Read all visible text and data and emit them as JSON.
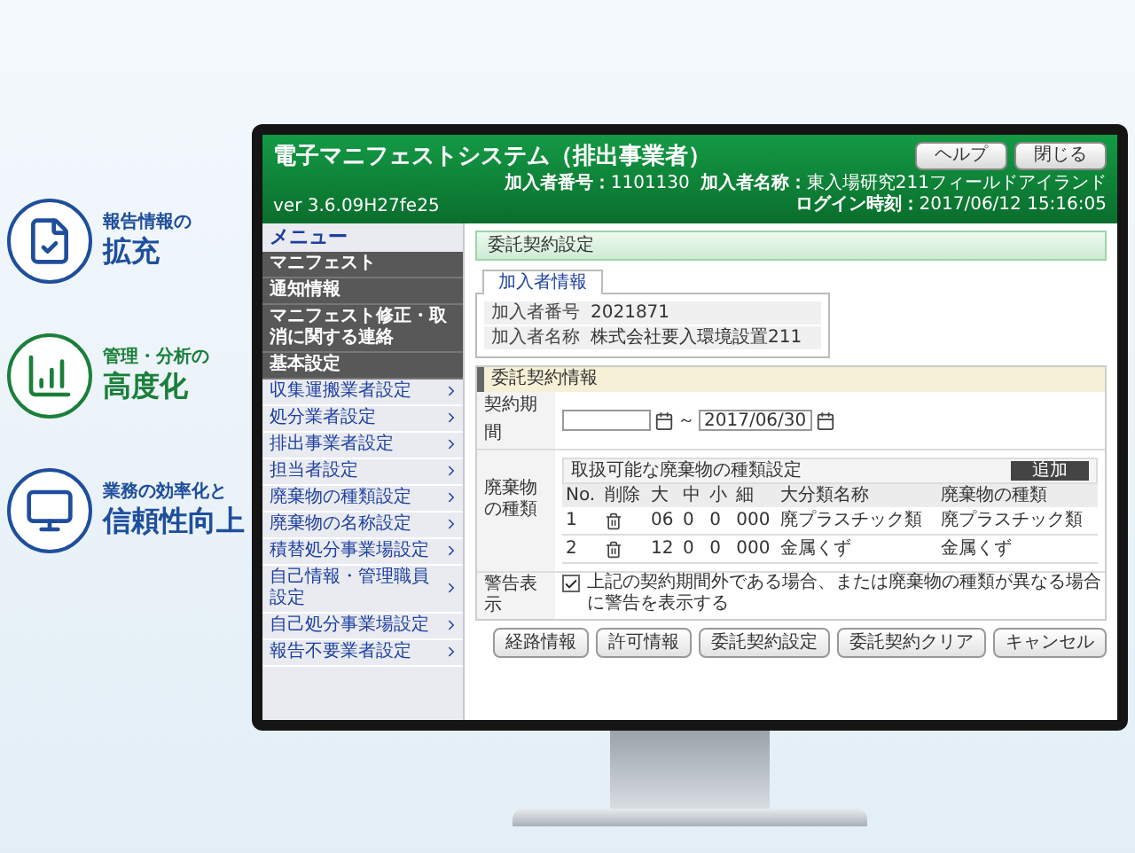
{
  "features": [
    {
      "kind": "document",
      "color": "#1f4e9c",
      "line1": "報告情報の",
      "line2": "拡充"
    },
    {
      "kind": "chart",
      "color": "#1b7f3a",
      "line1": "管理・分析の",
      "line2": "高度化"
    },
    {
      "kind": "monitor",
      "color": "#1f4e9c",
      "line1": "業務の効率化と",
      "line2": "信頼性向上"
    }
  ],
  "app": {
    "title": "電子マニフェストシステム（排出事業者）",
    "version": "ver 3.6.09H27fe25",
    "buttons": [
      "ヘルプ",
      "閉じる"
    ],
    "info": [
      {
        "label": "加入者番号：",
        "value": "1101130"
      },
      {
        "label": "加入者名称：",
        "value": "東入場研究211フィールドアイランド"
      },
      {
        "label": "ログイン時刻：",
        "value": "2017/06/12 15:16:05"
      }
    ]
  },
  "menu": {
    "title": "メニュー",
    "items": [
      {
        "kind": "header",
        "label": "マニフェスト"
      },
      {
        "kind": "header",
        "label": "通知情報"
      },
      {
        "kind": "header",
        "label": "マニフェスト修正・取消に関する連絡"
      },
      {
        "kind": "header",
        "label": "基本設定"
      },
      {
        "kind": "link",
        "label": "収集運搬業者設定"
      },
      {
        "kind": "link",
        "label": "処分業者設定"
      },
      {
        "kind": "link",
        "label": "排出事業者設定"
      },
      {
        "kind": "link",
        "label": "担当者設定"
      },
      {
        "kind": "link",
        "label": "廃棄物の種類設定"
      },
      {
        "kind": "link",
        "label": "廃棄物の名称設定"
      },
      {
        "kind": "link",
        "label": "積替処分事業場設定"
      },
      {
        "kind": "link",
        "label": "自己情報・管理職員設定"
      },
      {
        "kind": "link",
        "label": "自己処分事業場設定"
      },
      {
        "kind": "link",
        "label": "報告不要業者設定"
      }
    ]
  },
  "page": {
    "title": "委託契約設定",
    "tabs": [
      {
        "label": "加入者情報",
        "selected": true
      }
    ],
    "member_info": [
      {
        "label": "加入者番号",
        "value": "2021871"
      },
      {
        "label": "加入者名称",
        "value": "株式会社要入環境設置211"
      }
    ]
  },
  "contract": {
    "title": "委託契約情報",
    "period": {
      "label": "契約期間",
      "end": "2017/06/30",
      "separator": "～"
    },
    "waste": {
      "label": "廃棄物の種類",
      "table_title": "取扱可能な廃棄物の種類設定",
      "add_button": "追加",
      "columns": [
        "No.",
        "削除",
        "大",
        "中",
        "小",
        "細",
        "大分類名称",
        "廃棄物の種類"
      ],
      "rows": [
        {
          "no": "1",
          "major": "06",
          "middle": "0",
          "minor": "0",
          "detail": "000",
          "category": "廃プラスチック類",
          "type": "廃プラスチック類"
        },
        {
          "no": "2",
          "major": "12",
          "middle": "0",
          "minor": "0",
          "detail": "000",
          "category": "金属くず",
          "type": "金属くず"
        }
      ]
    },
    "warning": {
      "label": "警告表示",
      "checked": true,
      "text": "上記の契約期間外である場合、または廃棄物の種類が異なる場合に警告を表示する"
    }
  },
  "buttons": [
    "経路情報",
    "許可情報",
    "委託契約設定",
    "委託契約クリア",
    "キャンセル"
  ]
}
